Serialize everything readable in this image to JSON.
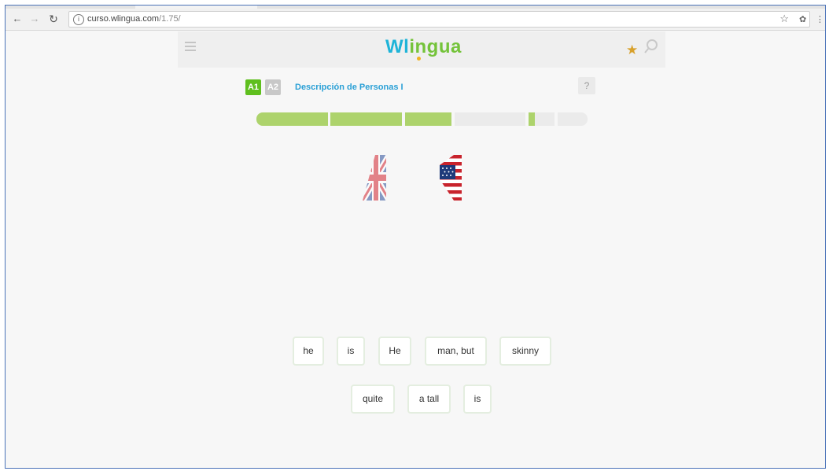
{
  "browser": {
    "url_host": "curso.wlingua.com",
    "url_path": "/1.75/",
    "back_icon": "arrow-left",
    "forward_icon": "arrow-right",
    "reload_icon": "reload",
    "info_icon": "info-circle",
    "bookmark_icon": "star",
    "extension_icon": "extension",
    "menu_icon": "vertical-dots"
  },
  "site": {
    "logo_part1": "Wl",
    "logo_part2": "ingua",
    "menu_icon": "hamburger",
    "trophy_icon": "trophy",
    "search_icon": "magnifier"
  },
  "lesson": {
    "levels": [
      "A1",
      "A2"
    ],
    "active_level": "A1",
    "title": "Descripción de Personas I",
    "help_label": "?",
    "progress_segments": [
      "done",
      "done",
      "done",
      "todo",
      "partial",
      "todo",
      "todo"
    ],
    "current_segment_fill": 0.25
  },
  "flags": {
    "left": "uk-flag",
    "right": "us-flag"
  },
  "words": {
    "row1": [
      "he",
      "is",
      "He",
      "man, but",
      "skinny"
    ],
    "row2": [
      "quite",
      "a tall",
      "is"
    ]
  },
  "colors": {
    "brand_blue": "#1fb4d8",
    "brand_green": "#74c33a",
    "level_active": "#5fbf1e",
    "progress_done": "#add36c",
    "progress_todo": "#ebebeb",
    "title_blue": "#2aa0d6"
  }
}
